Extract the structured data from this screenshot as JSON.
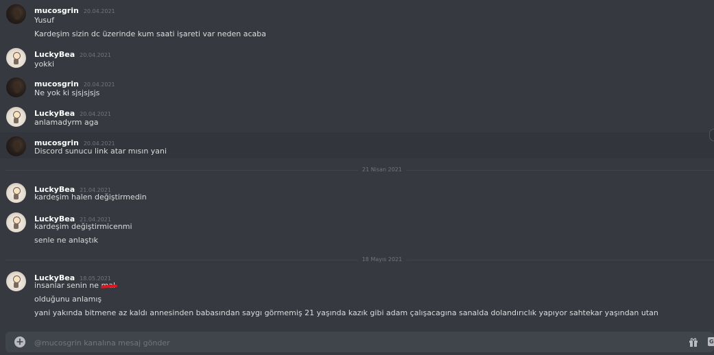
{
  "messages": [
    {
      "user": "mucosgrin",
      "time": "20.04.2021",
      "lines": [
        "Yusuf",
        "Kardeşim sizin dc üzerinde kum saati işareti var neden acaba"
      ]
    },
    {
      "user": "LuckyBea",
      "time": "20.04.2021",
      "lines": [
        "yokki"
      ]
    },
    {
      "user": "mucosgrin",
      "time": "20.04.2021",
      "lines": [
        "Ne yok ki sjsjsjsjs"
      ]
    },
    {
      "user": "LuckyBea",
      "time": "20.04.2021",
      "lines": [
        "anlamadyrm aga"
      ]
    },
    {
      "user": "mucosgrin",
      "time": "20.04.2021",
      "lines": [
        "Discord sunucu link atar mısın yani"
      ]
    },
    {
      "user": "LuckyBea",
      "time": "21.04.2021",
      "lines": [
        "kardeşim halen değiştirmedin"
      ]
    },
    {
      "user": "LuckyBea",
      "time": "21.04.2021",
      "lines": [
        "kardeşim değiştirmicenmi",
        "senle ne anlaştık"
      ]
    },
    {
      "user": "LuckyBea",
      "time": "18.05.2021",
      "lines": [
        "insanlar senin ne ",
        "olduğunu anlamış",
        "yani yakında bitmene az kaldı annesinden babasından saygı görmemiş 21 yaşında kazık gibi adam çalışacagına sanalda dolandırıclık yapıyor sahtekar yaşından utan"
      ],
      "redacted_word": "mal"
    }
  ],
  "dividers": [
    "21 Nisan 2021",
    "18 Mayıs 2021"
  ],
  "composer": {
    "placeholder": "@mucosgrin kanalına mesaj gönder",
    "value": ""
  },
  "icons": {
    "attach": "plus-circle-icon",
    "gift": "gift-icon",
    "gif": "gif-icon"
  },
  "colors": {
    "background": "#36393f",
    "composer": "#40444b",
    "username": "#ffffff",
    "timestamp": "#72767d",
    "text": "#dcddde",
    "redaction": "#e0161f"
  }
}
